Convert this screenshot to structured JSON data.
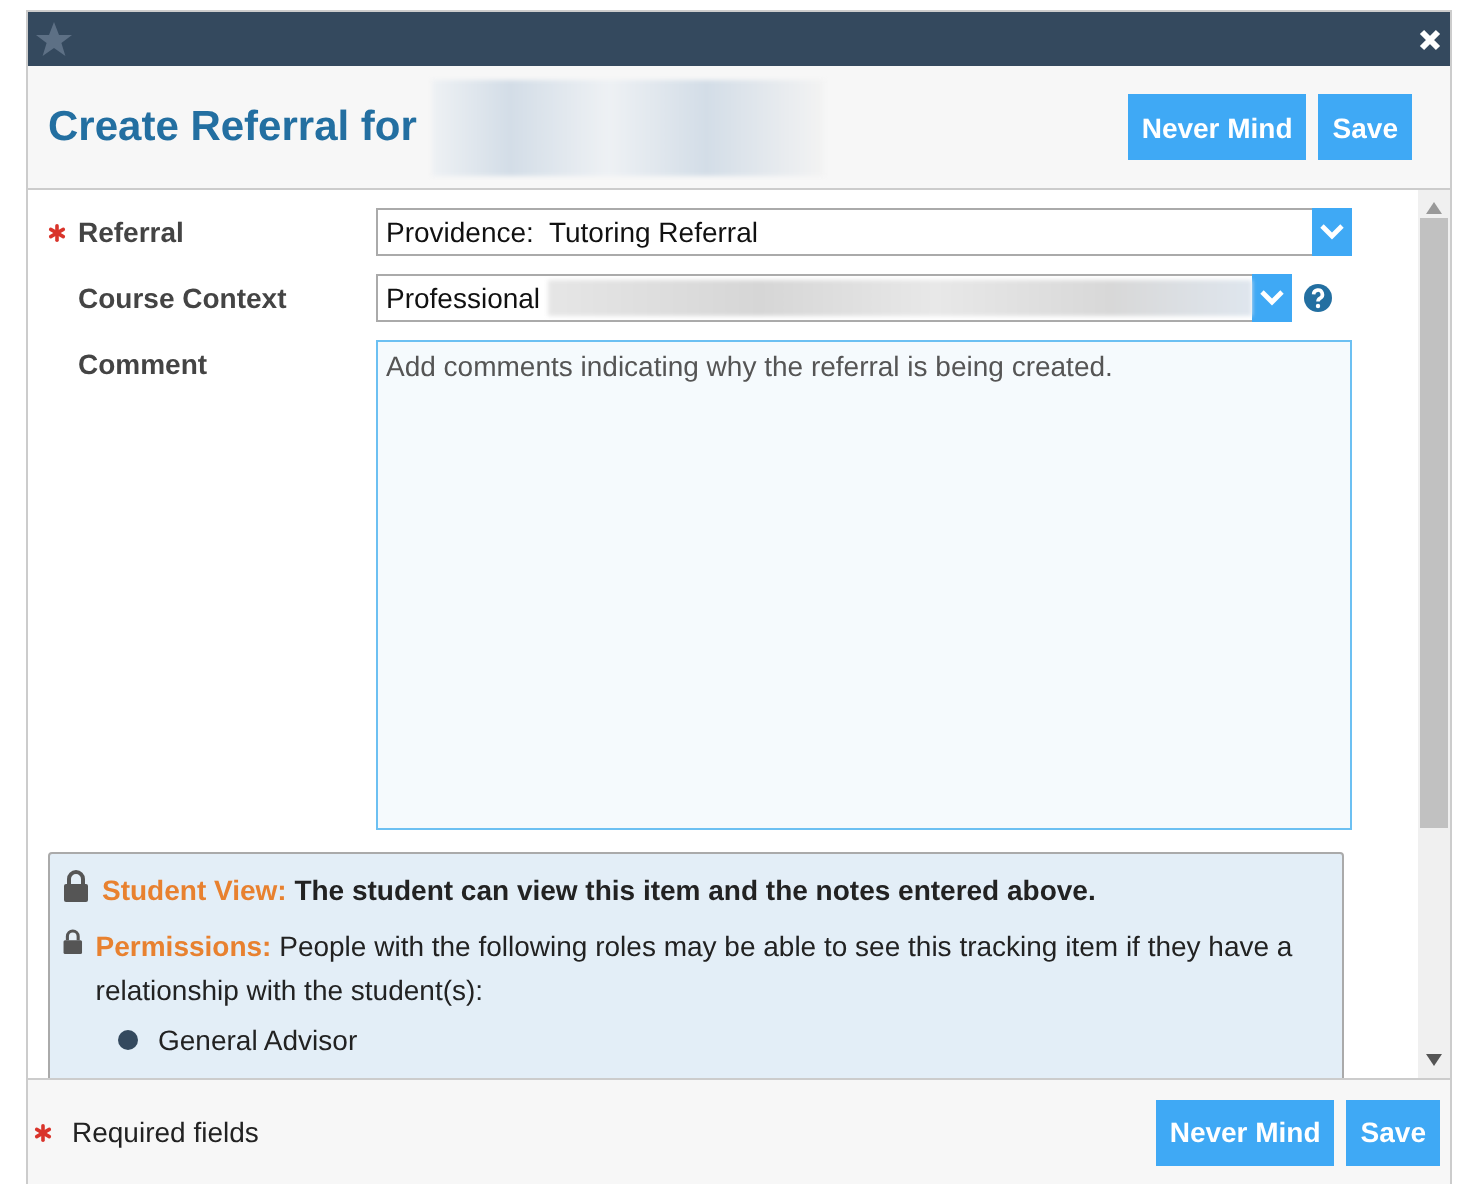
{
  "dialog": {
    "title": "Create Referral for"
  },
  "header_buttons": [
    "Never Mind",
    "Save"
  ],
  "fields": [
    {
      "kind": "select",
      "label": "Referral",
      "required": true,
      "value": "Providence:  Tutoring Referral",
      "help": false,
      "redacted": false
    },
    {
      "kind": "select",
      "label": "Course Context",
      "required": false,
      "value": "Professional",
      "help": true,
      "redacted": true
    },
    {
      "kind": "textarea",
      "label": "Comment",
      "required": false,
      "value": "Add comments indicating why the referral is being created."
    }
  ],
  "notices": [
    {
      "label": "Student View:",
      "text": "The student can view this item and the notes entered above.",
      "bold": true
    },
    {
      "label": "Permissions:",
      "text": "People with the following roles may be able to see this tracking item if they have a relationship with the student(s):",
      "bold": false,
      "roles": [
        "General Advisor"
      ]
    }
  ],
  "footer": {
    "required_note": "Required fields",
    "buttons": [
      "Never Mind",
      "Save"
    ]
  }
}
